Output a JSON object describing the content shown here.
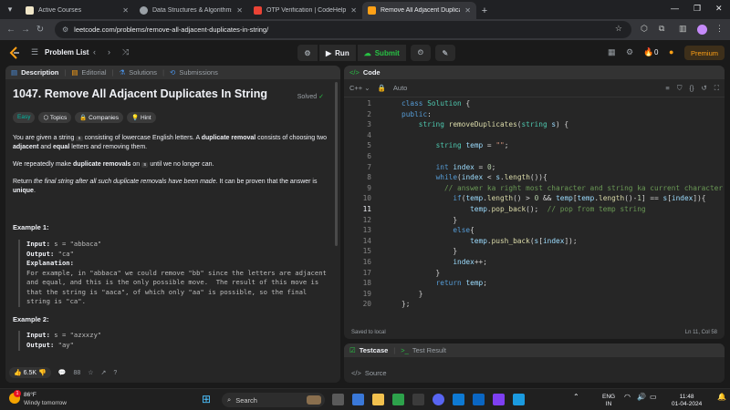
{
  "browser": {
    "tabs": [
      {
        "title": "Active Courses",
        "color": "#f0e6c8"
      },
      {
        "title": "Data Structures & Algorithms S",
        "color": "#9aa0a6"
      },
      {
        "title": "OTP Verification | CodeHelp - s",
        "color": "#ea4335"
      },
      {
        "title": "Remove All Adjacent Duplicate",
        "color": "#ffa116"
      }
    ],
    "active_tab": 3,
    "url": "leetcode.com/problems/remove-all-adjacent-duplicates-in-string/"
  },
  "lc_nav": {
    "problem_list": "Problem List",
    "run": "Run",
    "submit": "Submit",
    "streak": "0",
    "premium": "Premium"
  },
  "desc": {
    "tabs": [
      "Description",
      "Editorial",
      "Solutions",
      "Submissions"
    ],
    "title": "1047. Remove All Adjacent Duplicates In String",
    "status": "Solved",
    "chips": [
      "Easy",
      "Topics",
      "Companies",
      "Hint"
    ],
    "p1_a": "You are given a string ",
    "p1_code": "s",
    "p1_b": " consisting of lowercase English letters. A ",
    "p1_bold1": "duplicate removal",
    "p1_c": " consists of choosing two ",
    "p1_bold2": "adjacent",
    "p1_d": " and ",
    "p1_bold3": "equal",
    "p1_e": " letters and removing them.",
    "p2_a": "We repeatedly make ",
    "p2_bold": "duplicate removals",
    "p2_b": " on ",
    "p2_code": "s",
    "p2_c": " until we no longer can.",
    "p3_a": "Return ",
    "p3_it": "the final string after all such duplicate removals have been made",
    "p3_b": ". It can be proven that the answer is ",
    "p3_bold": "unique",
    "p3_c": ".",
    "ex1_title": "Example 1:",
    "ex1_input_label": "Input:",
    "ex1_input": " s = \"abbaca\"",
    "ex1_output_label": "Output:",
    "ex1_output": " \"ca\"",
    "ex1_expl_label": "Explanation:",
    "ex1_expl": "For example, in \"abbaca\" we could remove \"bb\" since the letters are adjacent\nand equal, and this is the only possible move.  The result of this move is\nthat the string is \"aaca\", of which only \"aa\" is possible, so the final\nstring is \"ca\".",
    "ex2_title": "Example 2:",
    "ex2_input_label": "Input:",
    "ex2_input": " s = \"azxxzy\"",
    "ex2_output_label": "Output:",
    "ex2_output": " \"ay\"",
    "likes": "6.5K",
    "comments": "88"
  },
  "code": {
    "header": "Code",
    "language": "C++",
    "mode": "Auto",
    "status_left": "Saved to local",
    "status_right": "Ln 11, Col 58",
    "current_line": 11
  },
  "testcase": {
    "tab1": "Testcase",
    "tab2": "Test Result",
    "source": "Source"
  },
  "taskbar": {
    "temp": "86°F",
    "forecast": "Windy tomorrow",
    "search": "Search",
    "lang1": "ENG",
    "lang2": "IN",
    "time": "11:48",
    "date": "01-04-2024"
  }
}
